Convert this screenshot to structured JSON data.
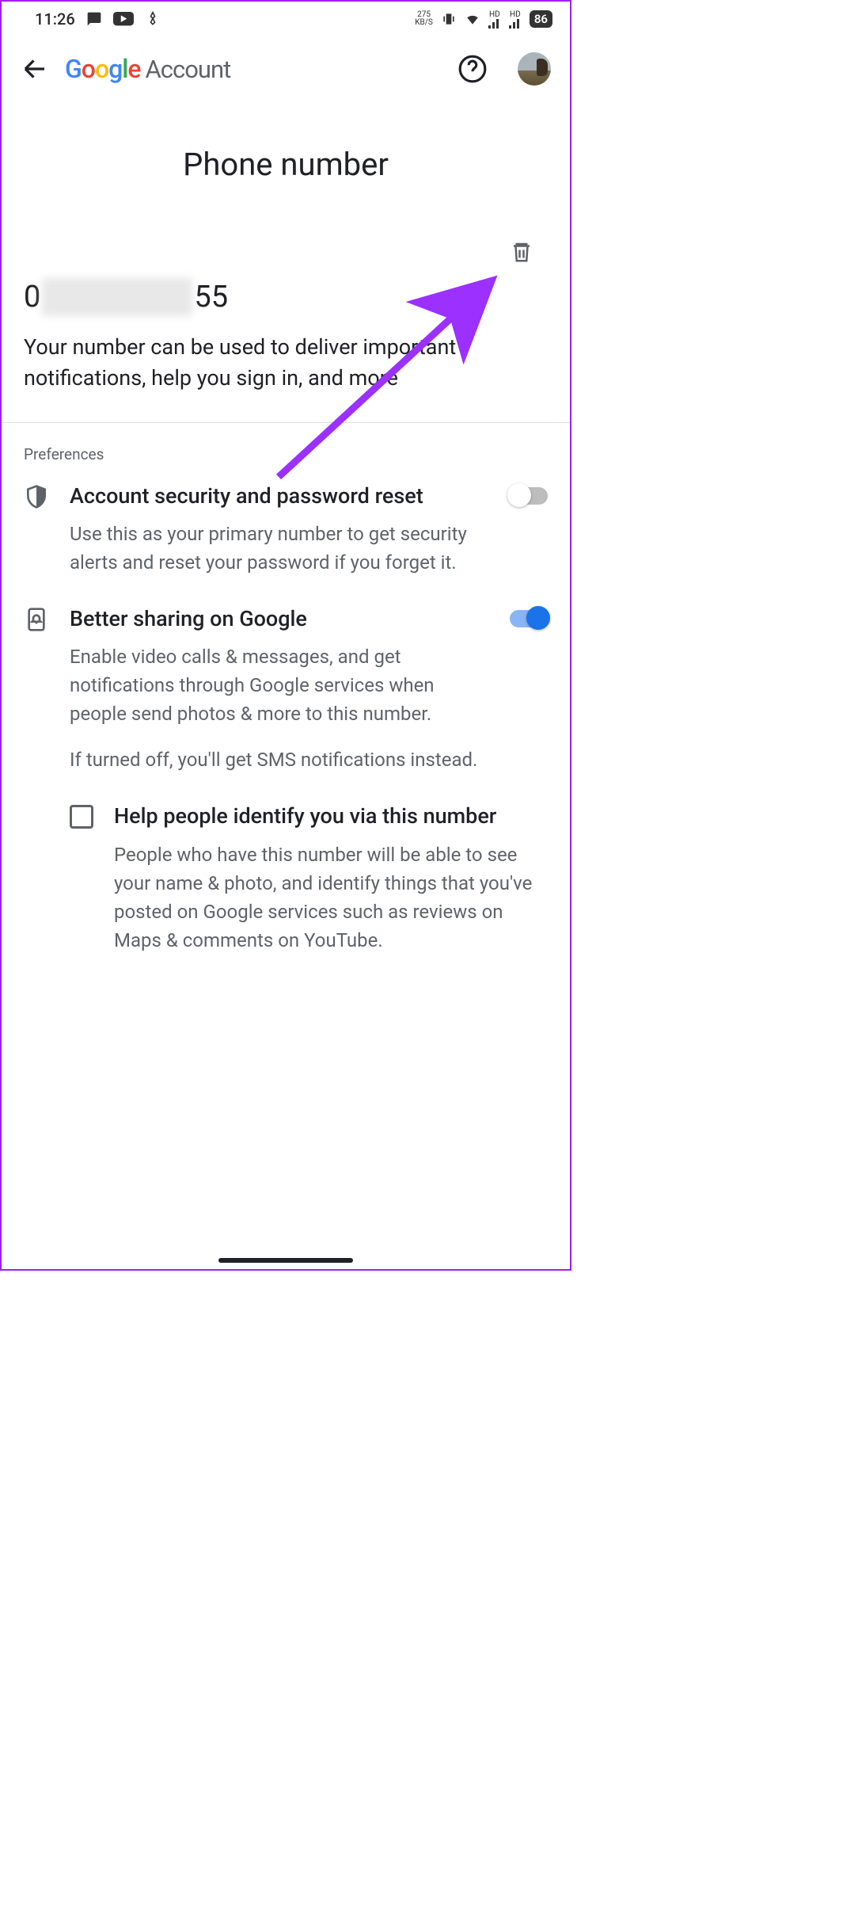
{
  "status_bar": {
    "time": "11:26",
    "net_speed_top": "275",
    "net_speed_bottom": "KB/S",
    "hd1": "HD",
    "hd2": "HD",
    "battery": "86"
  },
  "header": {
    "logo_account": "Account"
  },
  "page": {
    "title": "Phone number",
    "phone_prefix": "0",
    "phone_suffix": "55",
    "phone_description": "Your number can be used to deliver important notifications, help you sign in, and more"
  },
  "preferences": {
    "label": "Preferences",
    "items": [
      {
        "title": "Account security and password reset",
        "desc": "Use this as your primary number to get security alerts and reset your password if you forget it.",
        "toggle": "off"
      },
      {
        "title": "Better sharing on Google",
        "desc": "Enable video calls & messages, and get notifications through Google services when people send photos & more to this number.",
        "desc2": "If turned off, you'll get SMS notifications instead.",
        "toggle": "on"
      }
    ],
    "checkbox": {
      "title": "Help people identify you via this number",
      "desc": "People who have this number will be able to see your name & photo, and identify things that you've posted on Google services such as reviews on Maps & comments on YouTube."
    }
  }
}
